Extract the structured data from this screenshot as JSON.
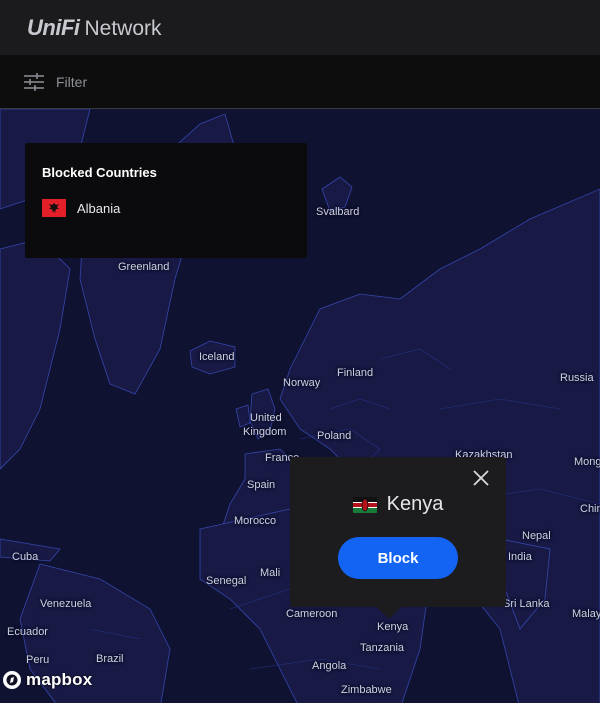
{
  "app": {
    "brand_logo": "UniFi",
    "brand_name": "Network"
  },
  "filter": {
    "label": "Filter",
    "icon": "sliders-icon"
  },
  "blocked_countries": {
    "title": "Blocked Countries",
    "items": [
      {
        "label": "Albania",
        "flag": "albania-flag-icon"
      }
    ]
  },
  "popup": {
    "country": "Kenya",
    "flag": "kenya-flag-icon",
    "action_label": "Block",
    "action_color": "#1464f4",
    "close_icon": "close-icon"
  },
  "map": {
    "labels": {
      "svalbard": "Svalbard",
      "greenland": "Greenland",
      "iceland": "Iceland",
      "finland": "Finland",
      "norway": "Norway",
      "russia": "Russia",
      "united": "United",
      "kingdom": "Kingdom",
      "poland": "Poland",
      "france": "France",
      "kazakhstan": "Kazakhstan",
      "mongolia": "Mong",
      "spain": "Spain",
      "morocco": "Morocco",
      "china": "Chin",
      "cuba": "Cuba",
      "nepal": "Nepal",
      "india": "India",
      "mali": "Mali",
      "senegal": "Senegal",
      "venezuela": "Venezuela",
      "cameroon": "Cameroon",
      "srilanka": "Sri Lanka",
      "malaysia": "Malay",
      "ecuador": "Ecuador",
      "kenya_map": "Kenya",
      "tanzania": "Tanzania",
      "peru": "Peru",
      "brazil": "Brazil",
      "angola": "Angola",
      "zimbabwe": "Zimbabwe"
    },
    "attribution": "mapbox",
    "attribution_icon": "mapbox-logo-icon"
  }
}
